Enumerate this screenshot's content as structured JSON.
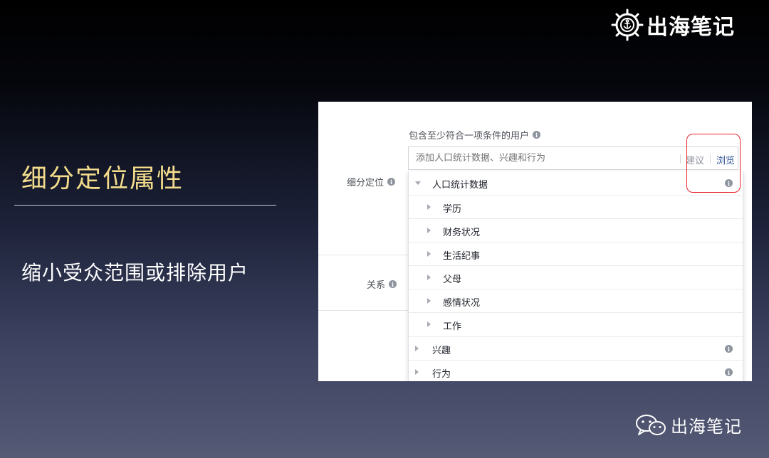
{
  "brand": {
    "name": "出海笔记",
    "icon": "ship-wheel-anchor-icon"
  },
  "slide": {
    "title": "细分定位属性",
    "subtitle": "缩小受众范围或排除用户",
    "title_color": "#f3dd8c"
  },
  "form": {
    "detailed_targeting_label": "细分定位",
    "relationship_label": "关系",
    "include_text": "包含至少符合一项条件的用户",
    "search": {
      "placeholder": "添加人口统计数据、兴趣和行为",
      "suggest_label": "建议",
      "browse_label": "浏览"
    },
    "info_icon": "i",
    "browse_color": "#365899"
  },
  "dropdown": {
    "items": [
      {
        "label": "人口统计数据",
        "expanded": true,
        "info": true
      },
      {
        "label": "学历",
        "indent": 1
      },
      {
        "label": "财务状况",
        "indent": 1
      },
      {
        "label": "生活纪事",
        "indent": 1
      },
      {
        "label": "父母",
        "indent": 1
      },
      {
        "label": "感情状况",
        "indent": 1
      },
      {
        "label": "工作",
        "indent": 1
      },
      {
        "label": "兴趣",
        "info": true
      },
      {
        "label": "行为",
        "info": true
      }
    ]
  },
  "annotation": {
    "highlight_color": "#e8262b"
  },
  "footer_brand": {
    "name": "出海笔记",
    "icon": "wechat-icon"
  }
}
